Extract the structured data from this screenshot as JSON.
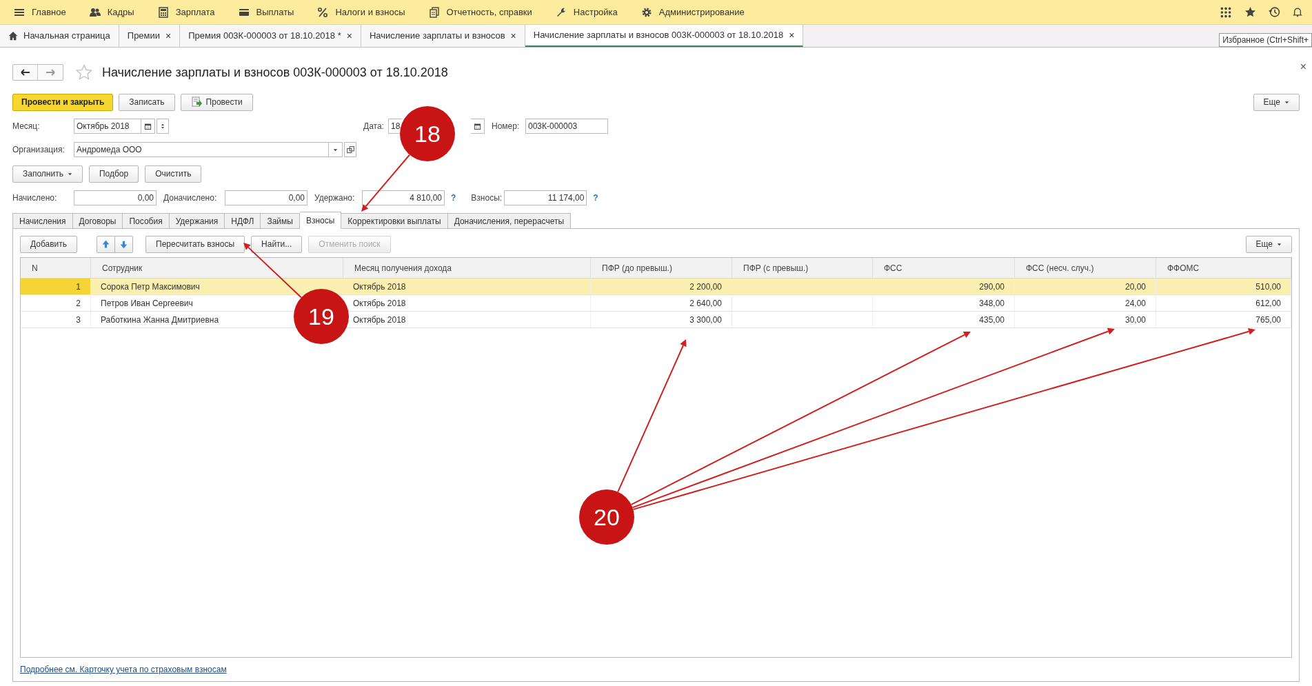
{
  "main_menu": [
    {
      "kind": "menu",
      "label": "Главное"
    },
    {
      "kind": "people",
      "label": "Кадры"
    },
    {
      "kind": "calculator",
      "label": "Зарплата"
    },
    {
      "kind": "card",
      "label": "Выплаты"
    },
    {
      "kind": "percent",
      "label": "Налоги и взносы"
    },
    {
      "kind": "docs",
      "label": "Отчетность, справки"
    },
    {
      "kind": "wrench",
      "label": "Настройка"
    },
    {
      "kind": "gear",
      "label": "Администрирование"
    }
  ],
  "open_tabs": [
    {
      "label": "Начальная страница",
      "home": true,
      "closable": false,
      "selected": false
    },
    {
      "label": "Премии",
      "home": false,
      "closable": true,
      "selected": false
    },
    {
      "label": "Премия 003К-000003 от 18.10.2018 *",
      "home": false,
      "closable": true,
      "selected": false
    },
    {
      "label": "Начисление зарплаты и взносов",
      "home": false,
      "closable": true,
      "selected": false
    },
    {
      "label": "Начисление зарплаты и взносов 003К-000003 от 18.10.2018",
      "home": false,
      "closable": true,
      "selected": true
    }
  ],
  "close_tab_glyph": "×",
  "tooltip": "Избранное (Ctrl+Shift+",
  "document": {
    "title": "Начисление зарплаты и взносов 003К-000003 от 18.10.2018",
    "favorite": false,
    "close": "×"
  },
  "buttons": [
    {
      "label": "Провести и закрыть",
      "kind": "primary"
    },
    {
      "label": "Записать",
      "kind": "plain"
    },
    {
      "label": "Провести",
      "kind": "post"
    }
  ],
  "more_button": "Еще",
  "month": {
    "label": "Месяц:",
    "value": "Октябрь 2018"
  },
  "date": {
    "label": "Дата:",
    "value": "18"
  },
  "number": {
    "label": "Номер:",
    "value": "003К-000003"
  },
  "organization": {
    "label": "Организация:",
    "value": "Андромеда ООО"
  },
  "fill_buttons": [
    {
      "label": "Заполнить",
      "dropdown": true
    },
    {
      "label": "Подбор",
      "dropdown": false
    },
    {
      "label": "Очистить",
      "dropdown": false
    }
  ],
  "totals": [
    {
      "label": "Начислено:",
      "value": "0,00"
    },
    {
      "label": "Доначислено:",
      "value": "0,00"
    },
    {
      "label": "Удержано:",
      "value": "4 810,00",
      "help": "?"
    },
    {
      "label": "Взносы:",
      "value": "11 174,00",
      "help": "?"
    }
  ],
  "section_tabs": [
    {
      "label": "Начисления",
      "selected": false
    },
    {
      "label": "Договоры",
      "selected": false
    },
    {
      "label": "Пособия",
      "selected": false
    },
    {
      "label": "Удержания",
      "selected": false
    },
    {
      "label": "НДФЛ",
      "selected": false
    },
    {
      "label": "Займы",
      "selected": false
    },
    {
      "label": "Взносы",
      "selected": true
    },
    {
      "label": "Корректировки выплаты",
      "selected": false
    },
    {
      "label": "Доначисления, перерасчеты",
      "selected": false
    }
  ],
  "table_toolbar": [
    {
      "kind": "button",
      "label": "Добавить",
      "disabled": false
    },
    {
      "kind": "updown"
    },
    {
      "kind": "button",
      "label": "Пересчитать взносы",
      "disabled": false
    },
    {
      "kind": "button",
      "label": "Найти...",
      "disabled": false
    },
    {
      "kind": "button",
      "label": "Отменить поиск",
      "disabled": true
    }
  ],
  "table_more": "Еще",
  "table": {
    "columns": [
      "N",
      "Сотрудник",
      "Месяц получения дохода",
      "ПФР (до превыш.)",
      "ПФР (с превыш.)",
      "ФСС",
      "ФСС (несч. случ.)",
      "ФФОМС"
    ],
    "rows": [
      {
        "selected": true,
        "cells": [
          "1",
          "Сорока Петр Максимович",
          "Октябрь 2018",
          "2 200,00",
          "",
          "290,00",
          "20,00",
          "510,00"
        ]
      },
      {
        "selected": false,
        "cells": [
          "2",
          "Петров Иван Сергеевич",
          "Октябрь 2018",
          "2 640,00",
          "",
          "348,00",
          "24,00",
          "612,00"
        ]
      },
      {
        "selected": false,
        "cells": [
          "3",
          "Работкина Жанна Дмитриевна",
          "Октябрь 2018",
          "3 300,00",
          "",
          "435,00",
          "30,00",
          "765,00"
        ]
      }
    ]
  },
  "footer_link": "Подробнее см. Карточку учета по страховым взносам",
  "annotations": [
    {
      "label": "18"
    },
    {
      "label": "19"
    },
    {
      "label": "20"
    }
  ]
}
